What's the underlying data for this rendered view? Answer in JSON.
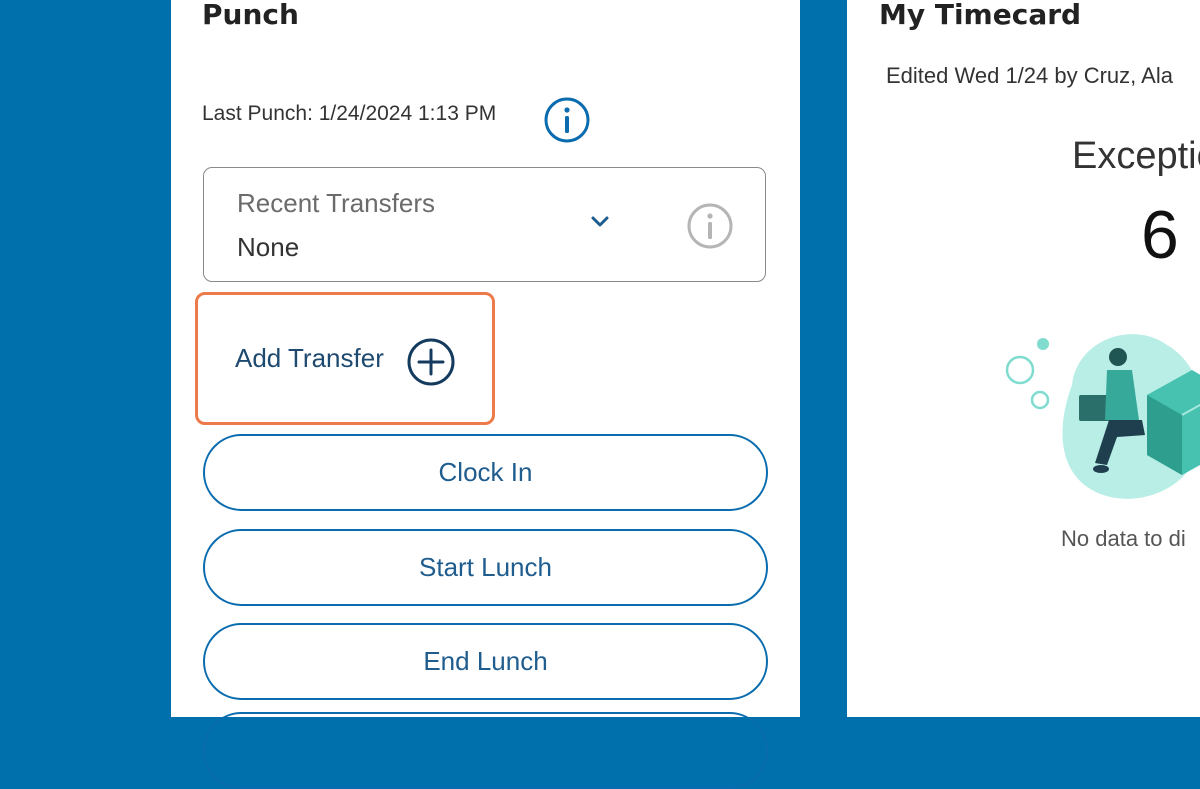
{
  "punch": {
    "title": "Punch",
    "last_punch": "Last Punch: 1/24/2024 1:13 PM",
    "recent_transfers": {
      "label": "Recent Transfers",
      "value": "None"
    },
    "add_transfer_label": "Add Transfer",
    "buttons": {
      "clock_in": "Clock In",
      "start_lunch": "Start Lunch",
      "end_lunch": "End Lunch"
    }
  },
  "timecard": {
    "title": "My Timecard",
    "edited": "Edited Wed 1/24 by Cruz, Ala",
    "exceptions_label": "Exceptio",
    "exceptions_count": "6",
    "no_data": "No data to di"
  },
  "colors": {
    "background": "#0070ad",
    "accent": "#0a6cae",
    "focus_outline": "#ec7a4a",
    "illustration": "#5fd6c4"
  },
  "icons": [
    "info-icon",
    "chevron-down-icon",
    "add-circle-icon"
  ]
}
